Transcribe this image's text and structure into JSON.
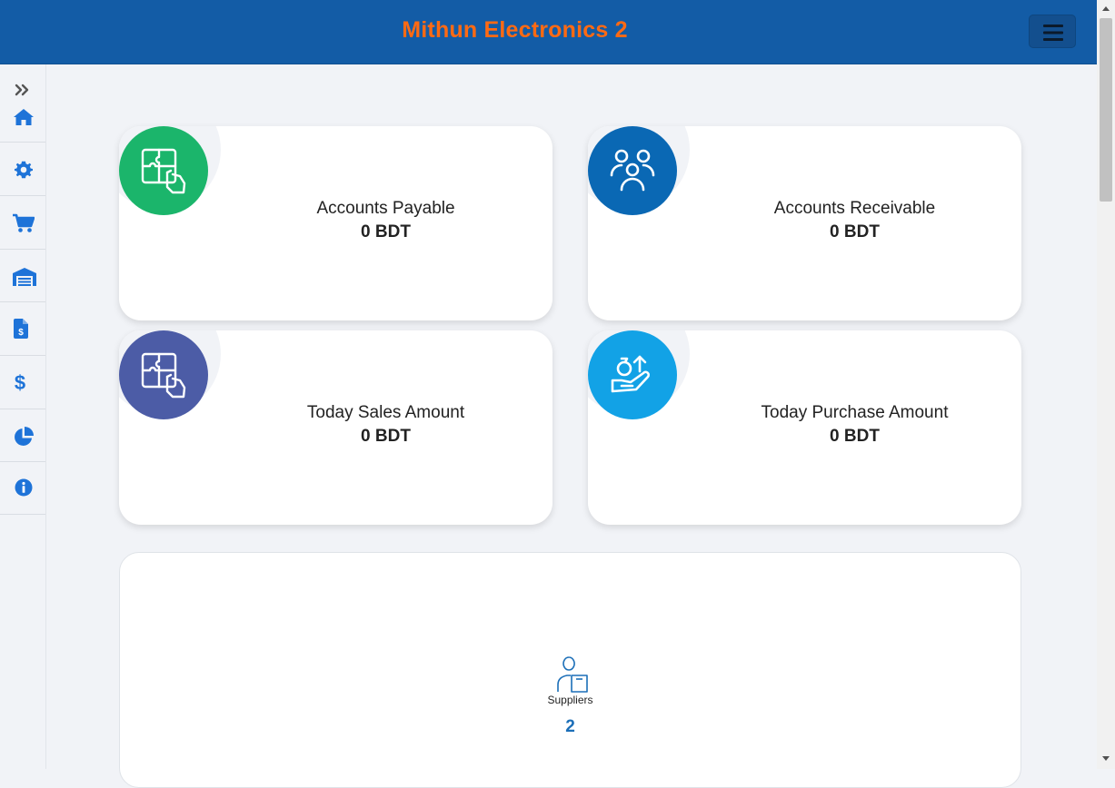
{
  "header": {
    "title": "Mithun Electronics 2",
    "menu_icon": "hamburger-icon"
  },
  "sidebar": {
    "items": [
      {
        "icon": "expand-chevrons-icon"
      },
      {
        "icon": "home-icon"
      },
      {
        "icon": "gear-icon"
      },
      {
        "icon": "cart-icon"
      },
      {
        "icon": "warehouse-icon"
      },
      {
        "icon": "invoice-icon"
      },
      {
        "icon": "dollar-icon"
      },
      {
        "icon": "pie-chart-icon"
      },
      {
        "icon": "info-icon"
      }
    ]
  },
  "cards": [
    {
      "label": "Accounts Payable",
      "value": "0 BDT",
      "icon": "puzzle-hand-icon",
      "color": "#1bb56b"
    },
    {
      "label": "Accounts Receivable",
      "value": "0 BDT",
      "icon": "users-group-icon",
      "color": "#0a68b4"
    },
    {
      "label": "Today Sales Amount",
      "value": "0 BDT",
      "icon": "puzzle-hand-icon",
      "color": "#4c5ca6"
    },
    {
      "label": "Today Purchase Amount",
      "value": "0 BDT",
      "icon": "hand-money-up-icon",
      "color": "#12a2e6"
    }
  ],
  "suppliers": {
    "label": "Suppliers",
    "count": "2",
    "icon": "supplier-person-box-icon"
  },
  "colors": {
    "header_bg": "#135ca6",
    "brand_text": "#ff6a13",
    "sidebar_icon": "#1e73d8",
    "page_bg": "#f1f3f7"
  }
}
